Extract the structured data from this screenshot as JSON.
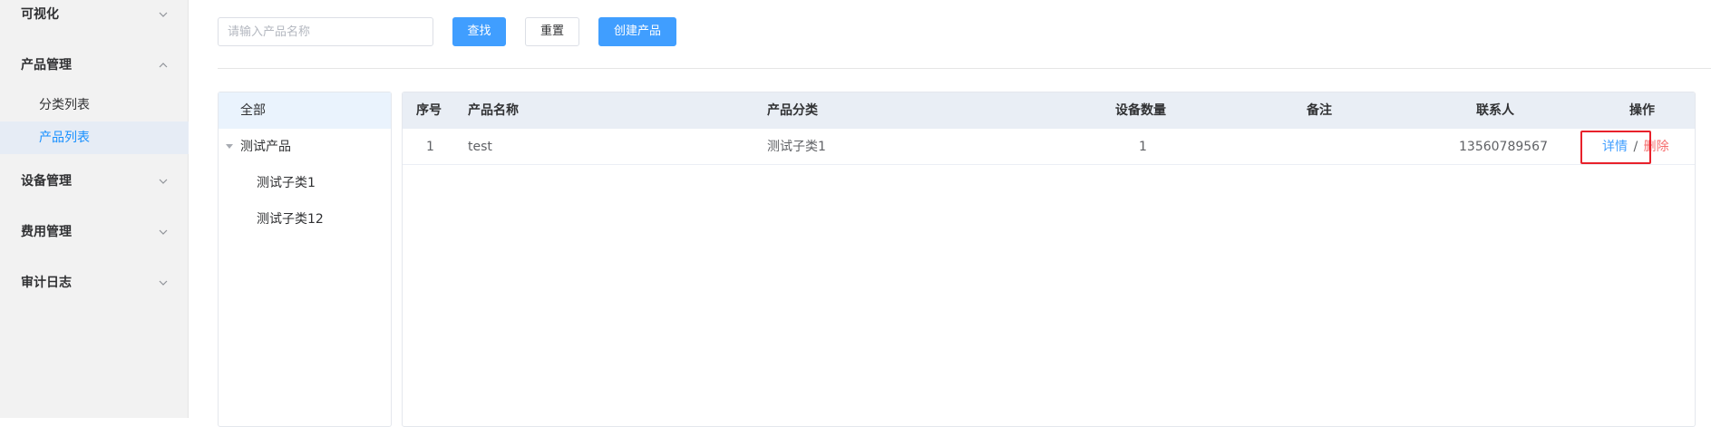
{
  "sidebar": {
    "menus": [
      {
        "label": "可视化",
        "icon": "chevron-down-icon"
      },
      {
        "label": "产品管理",
        "icon": "chevron-up-icon"
      },
      {
        "label": "设备管理",
        "icon": "chevron-down-icon"
      },
      {
        "label": "费用管理",
        "icon": "chevron-down-icon"
      },
      {
        "label": "审计日志",
        "icon": "chevron-down-icon"
      }
    ],
    "submenu": [
      {
        "label": "分类列表"
      },
      {
        "label": "产品列表"
      }
    ]
  },
  "toolbar": {
    "search_placeholder": "请输入产品名称",
    "search_value": "",
    "find_label": "查找",
    "reset_label": "重置",
    "create_label": "创建产品"
  },
  "tree": {
    "all": "全部",
    "parent": "测试产品",
    "children": [
      "测试子类1",
      "测试子类12"
    ]
  },
  "table": {
    "columns": [
      "序号",
      "产品名称",
      "产品分类",
      "设备数量",
      "备注",
      "联系人",
      "操作"
    ],
    "rows": [
      {
        "index": "1",
        "name": "test",
        "category": "测试子类1",
        "device_count": "1",
        "note": "",
        "contact": "13560789567"
      }
    ],
    "actions": {
      "detail": "详情",
      "separator": "/",
      "delete": "删除"
    }
  },
  "colors": {
    "primary": "#409eff",
    "active_menu_text": "#1890ff",
    "delete": "#f56c6c",
    "highlight": "#e8212b"
  }
}
